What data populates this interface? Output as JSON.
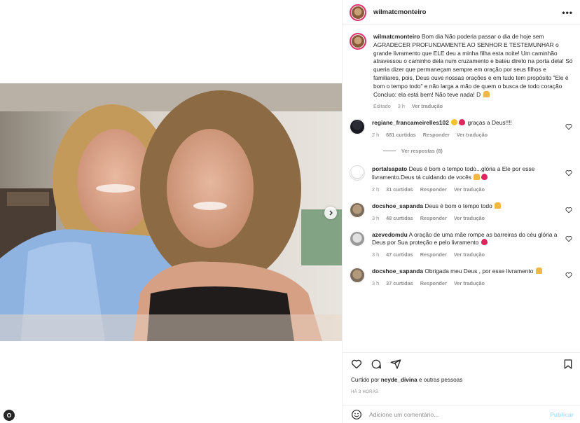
{
  "post": {
    "username": "wilmatcmonteiro",
    "caption_text": "Bom dia Não poderia passar o dia de hoje sem AGRADECER PROFUNDAMENTE AO SENHOR E TESTEMUNHAR o grande livramento que ELE deu a minha filha esta noite! Um caminhão atravessou o caminho dela num cruzamento e bateu direto na porta dela! Só queria dizer que permaneçam sempre em oração por seus filhos e familiares, pois, Deus ouve nossas orações e em tudo tem propósito \"Ele é bom o tempo todo\" e não larga a mão de quem o busca de todo coração Concluo: ela está bem! Não teve nada! D",
    "caption_meta": {
      "status": "Editado",
      "time": "3 h",
      "translate": "Ver tradução"
    },
    "liked_by": {
      "prefix": "Curtido por",
      "user": "neyde_divina",
      "suffix": "e outras pessoas"
    },
    "posted_ago": "HÁ 3 HORAS"
  },
  "comments": [
    {
      "user": "regiane_francameirelles102",
      "text": " graças a Deus!!!!",
      "time": "2 h",
      "likes": "681 curtidas",
      "reply": "Responder",
      "translate": "Ver tradução",
      "replies_label": "Ver respostas (8)"
    },
    {
      "user": "portalsapato",
      "text": "Deus é bom o tempo todo...glória a Ele por esse livramento.Deus tá cuidando de vocês",
      "time": "2 h",
      "likes": "31 curtidas",
      "reply": "Responder",
      "translate": "Ver tradução"
    },
    {
      "user": "docshoe_sapanda",
      "text": "Deus é bom o tempo todo",
      "time": "3 h",
      "likes": "48 curtidas",
      "reply": "Responder",
      "translate": "Ver tradução"
    },
    {
      "user": "azevedomdu",
      "text": "A oração de uma mãe rompe as barreiras do céu glória a Deus por Sua proteção e pelo livramento",
      "time": "3 h",
      "likes": "47 curtidas",
      "reply": "Responder",
      "translate": "Ver tradução"
    },
    {
      "user": "docshoe_sapanda",
      "text": "Obrigada meu Deus , por esse livramento",
      "time": "3 h",
      "likes": "37 curtidas",
      "reply": "Responder",
      "translate": "Ver tradução"
    }
  ],
  "composer": {
    "placeholder": "Adicione um comentário...",
    "publish": "Publicar"
  },
  "icons": {
    "more": "more-horizontal-icon",
    "like": "heart-icon",
    "comment": "comment-icon",
    "share": "share-icon",
    "save": "bookmark-icon",
    "emoji": "emoji-icon",
    "next": "chevron-right-icon",
    "corner": "threads-icon"
  },
  "colors": {
    "accent": "#0095f6",
    "like_red": "#e0245e",
    "muted": "#8e8e8e",
    "publish_disabled": "#b2dffc"
  }
}
